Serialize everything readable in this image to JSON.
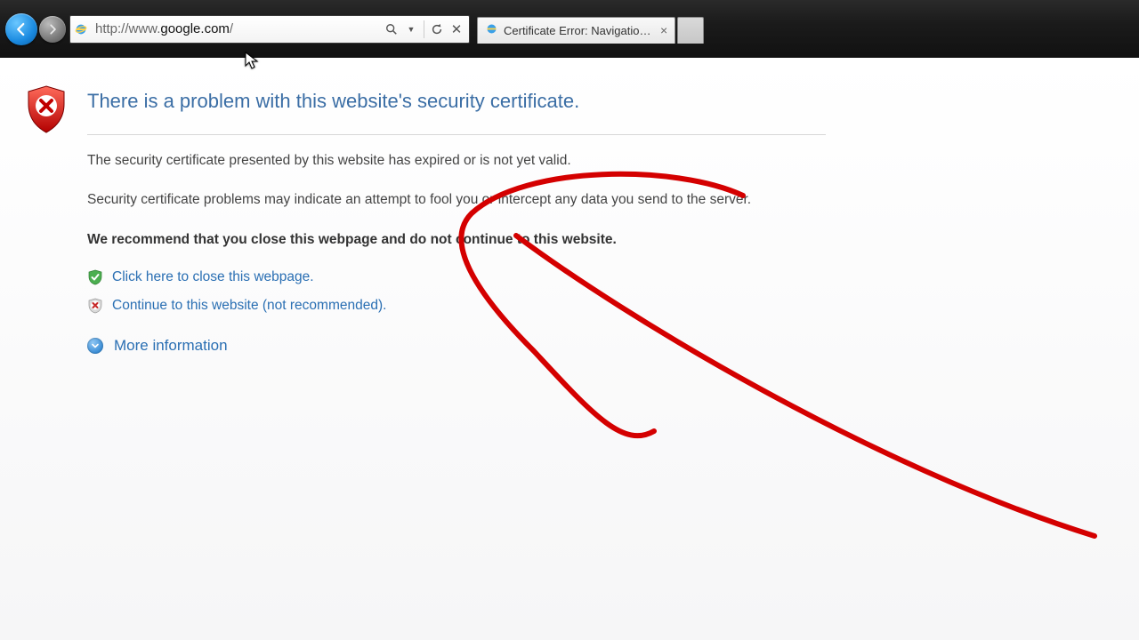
{
  "address_bar": {
    "url_prefix": "http://www.",
    "url_domain": "google.com",
    "url_suffix": "/"
  },
  "tab": {
    "title": "Certificate Error: Navigation..."
  },
  "page": {
    "heading": "There is a problem with this website's security certificate.",
    "line1": "The security certificate presented by this website has expired or is not yet valid.",
    "line2": "Security certificate problems may indicate an attempt to fool you or intercept any data you send to the server.",
    "recommend": "We recommend that you close this webpage and do not continue to this website.",
    "close_link": "Click here to close this webpage.",
    "continue_link": "Continue to this website (not recommended).",
    "more_info": "More information"
  }
}
